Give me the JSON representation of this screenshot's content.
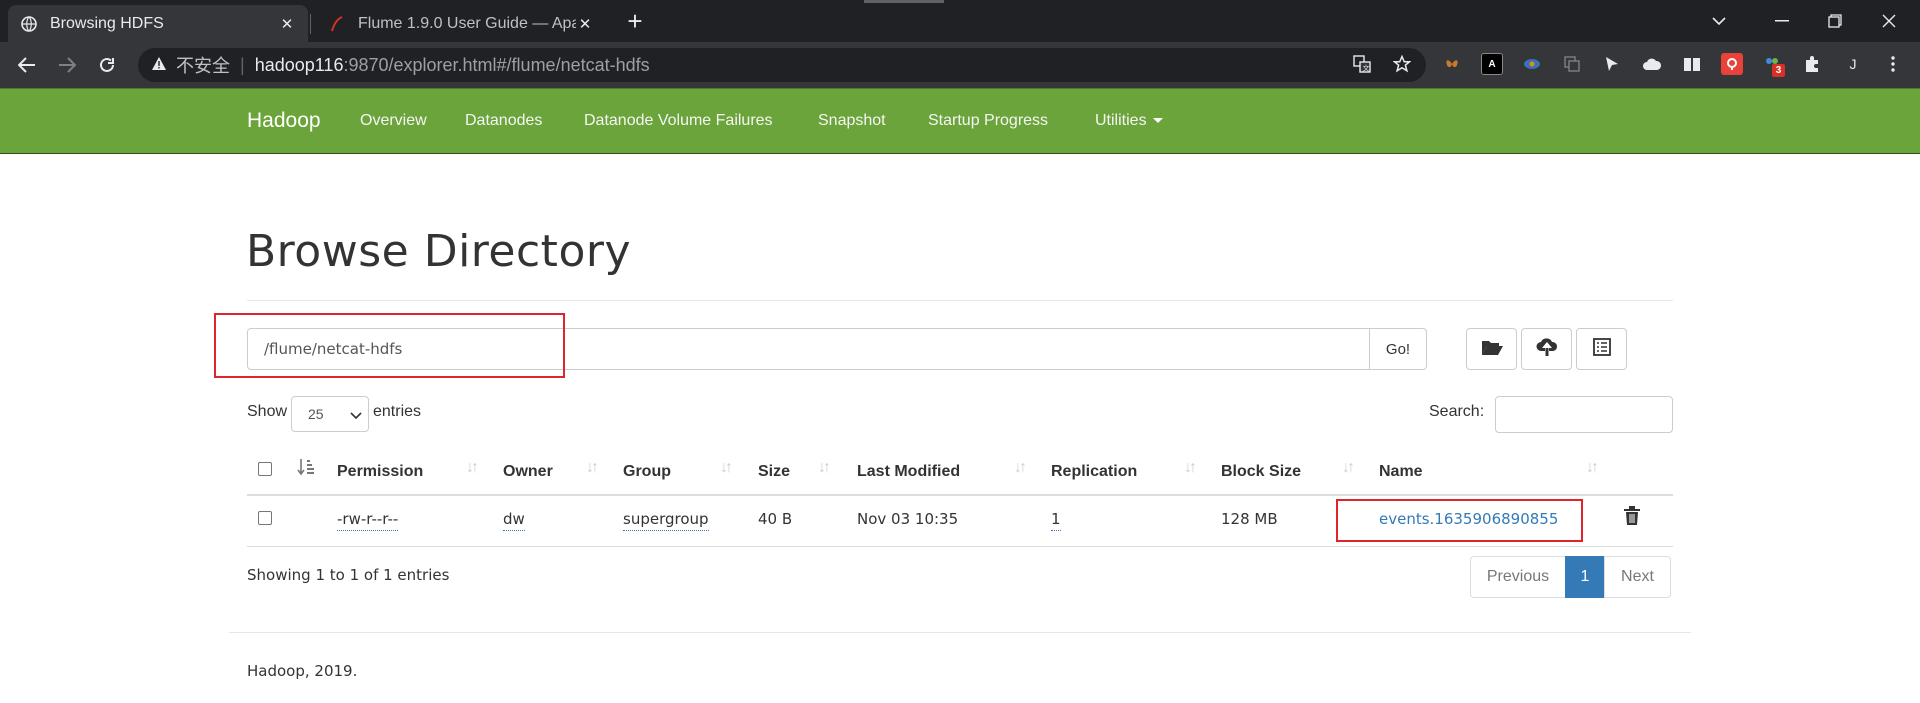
{
  "browser": {
    "tabs": [
      {
        "title": "Browsing HDFS",
        "close": "✕"
      },
      {
        "title": "Flume 1.9.0 User Guide — Apa",
        "close": "✕"
      }
    ],
    "new_tab": "+",
    "address": {
      "insecure_label": "不安全",
      "host": "hadoop116",
      "rest": ":9870/explorer.html#/flume/netcat-hdfs"
    },
    "profile_initial": "J",
    "extension_badge": "3"
  },
  "navbar": {
    "brand": "Hadoop",
    "links": [
      "Overview",
      "Datanodes",
      "Datanode Volume Failures",
      "Snapshot",
      "Startup Progress",
      "Utilities"
    ]
  },
  "page": {
    "title": "Browse Directory",
    "path_value": "/flume/netcat-hdfs",
    "go_label": "Go!",
    "show_label": "Show",
    "entries_per_page": "25",
    "entries_label": "entries",
    "search_label": "Search:",
    "search_value": ""
  },
  "table": {
    "columns": [
      "Permission",
      "Owner",
      "Group",
      "Size",
      "Last Modified",
      "Replication",
      "Block Size",
      "Name"
    ],
    "rows": [
      {
        "permission": "-rw-r--r--",
        "owner": "dw",
        "group": "supergroup",
        "size": "40 B",
        "last_modified": "Nov 03 10:35",
        "replication": "1",
        "block_size": "128 MB",
        "name": "events.1635906890855"
      }
    ]
  },
  "pagination": {
    "info": "Showing 1 to 1 of 1 entries",
    "previous": "Previous",
    "current": "1",
    "next": "Next"
  },
  "footer": {
    "text": "Hadoop, 2019."
  },
  "colors": {
    "navbar_green": "#6ba43a",
    "link_blue": "#337ab7",
    "highlight_red": "#e0242a",
    "chrome_dark": "#202124"
  }
}
